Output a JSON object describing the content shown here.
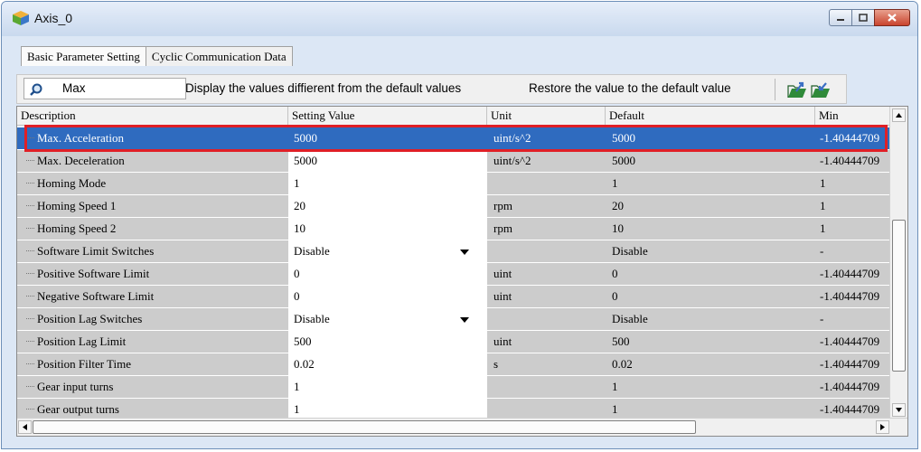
{
  "window": {
    "title": "Axis_0"
  },
  "tabs": [
    {
      "label": "Basic Parameter Setting"
    },
    {
      "label": "Cyclic Communication Data"
    }
  ],
  "toolbar": {
    "search_value": "Max",
    "show_diff_label": "Display the values diffierent from the default values",
    "restore_label": "Restore the value to the default value"
  },
  "table": {
    "headers": {
      "description": "Description",
      "setting": "Setting Value",
      "unit": "Unit",
      "default": "Default",
      "min": "Min"
    },
    "rows": [
      {
        "desc": "Max. Acceleration",
        "value": "5000",
        "unit": "uint/s^2",
        "default": "5000",
        "min": "-1.40444709"
      },
      {
        "desc": "Max. Deceleration",
        "value": "5000",
        "unit": "uint/s^2",
        "default": "5000",
        "min": "-1.40444709"
      },
      {
        "desc": "Homing Mode",
        "value": "1",
        "unit": "",
        "default": "1",
        "min": "1"
      },
      {
        "desc": "Homing Speed 1",
        "value": "20",
        "unit": "rpm",
        "default": "20",
        "min": "1"
      },
      {
        "desc": "Homing Speed 2",
        "value": "10",
        "unit": "rpm",
        "default": "10",
        "min": "1"
      },
      {
        "desc": "Software Limit Switches",
        "value": "Disable",
        "unit": "",
        "default": "Disable",
        "min": "-"
      },
      {
        "desc": "Positive Software Limit",
        "value": "0",
        "unit": "uint",
        "default": "0",
        "min": "-1.40444709"
      },
      {
        "desc": "Negative Software Limit",
        "value": "0",
        "unit": "uint",
        "default": "0",
        "min": "-1.40444709"
      },
      {
        "desc": "Position Lag Switches",
        "value": "Disable",
        "unit": "",
        "default": "Disable",
        "min": "-"
      },
      {
        "desc": "Position Lag Limit",
        "value": "500",
        "unit": "uint",
        "default": "500",
        "min": "-1.40444709"
      },
      {
        "desc": "Position Filter Time",
        "value": "0.02",
        "unit": "s",
        "default": "0.02",
        "min": "-1.40444709"
      },
      {
        "desc": "Gear input turns",
        "value": "1",
        "unit": "",
        "default": "1",
        "min": "-1.40444709"
      },
      {
        "desc": "Gear output turns",
        "value": "1",
        "unit": "",
        "default": "1",
        "min": "-1.40444709"
      }
    ]
  },
  "colors": {
    "selected_row": "#2f6bbf",
    "highlight_box": "#e01f26",
    "readonly_cell": "#cccccc"
  },
  "icons": [
    "app-cube-icon",
    "minimize-icon",
    "maximize-icon",
    "close-icon",
    "search-icon",
    "export-icon",
    "import-icon",
    "dropdown-arrow-icon"
  ]
}
